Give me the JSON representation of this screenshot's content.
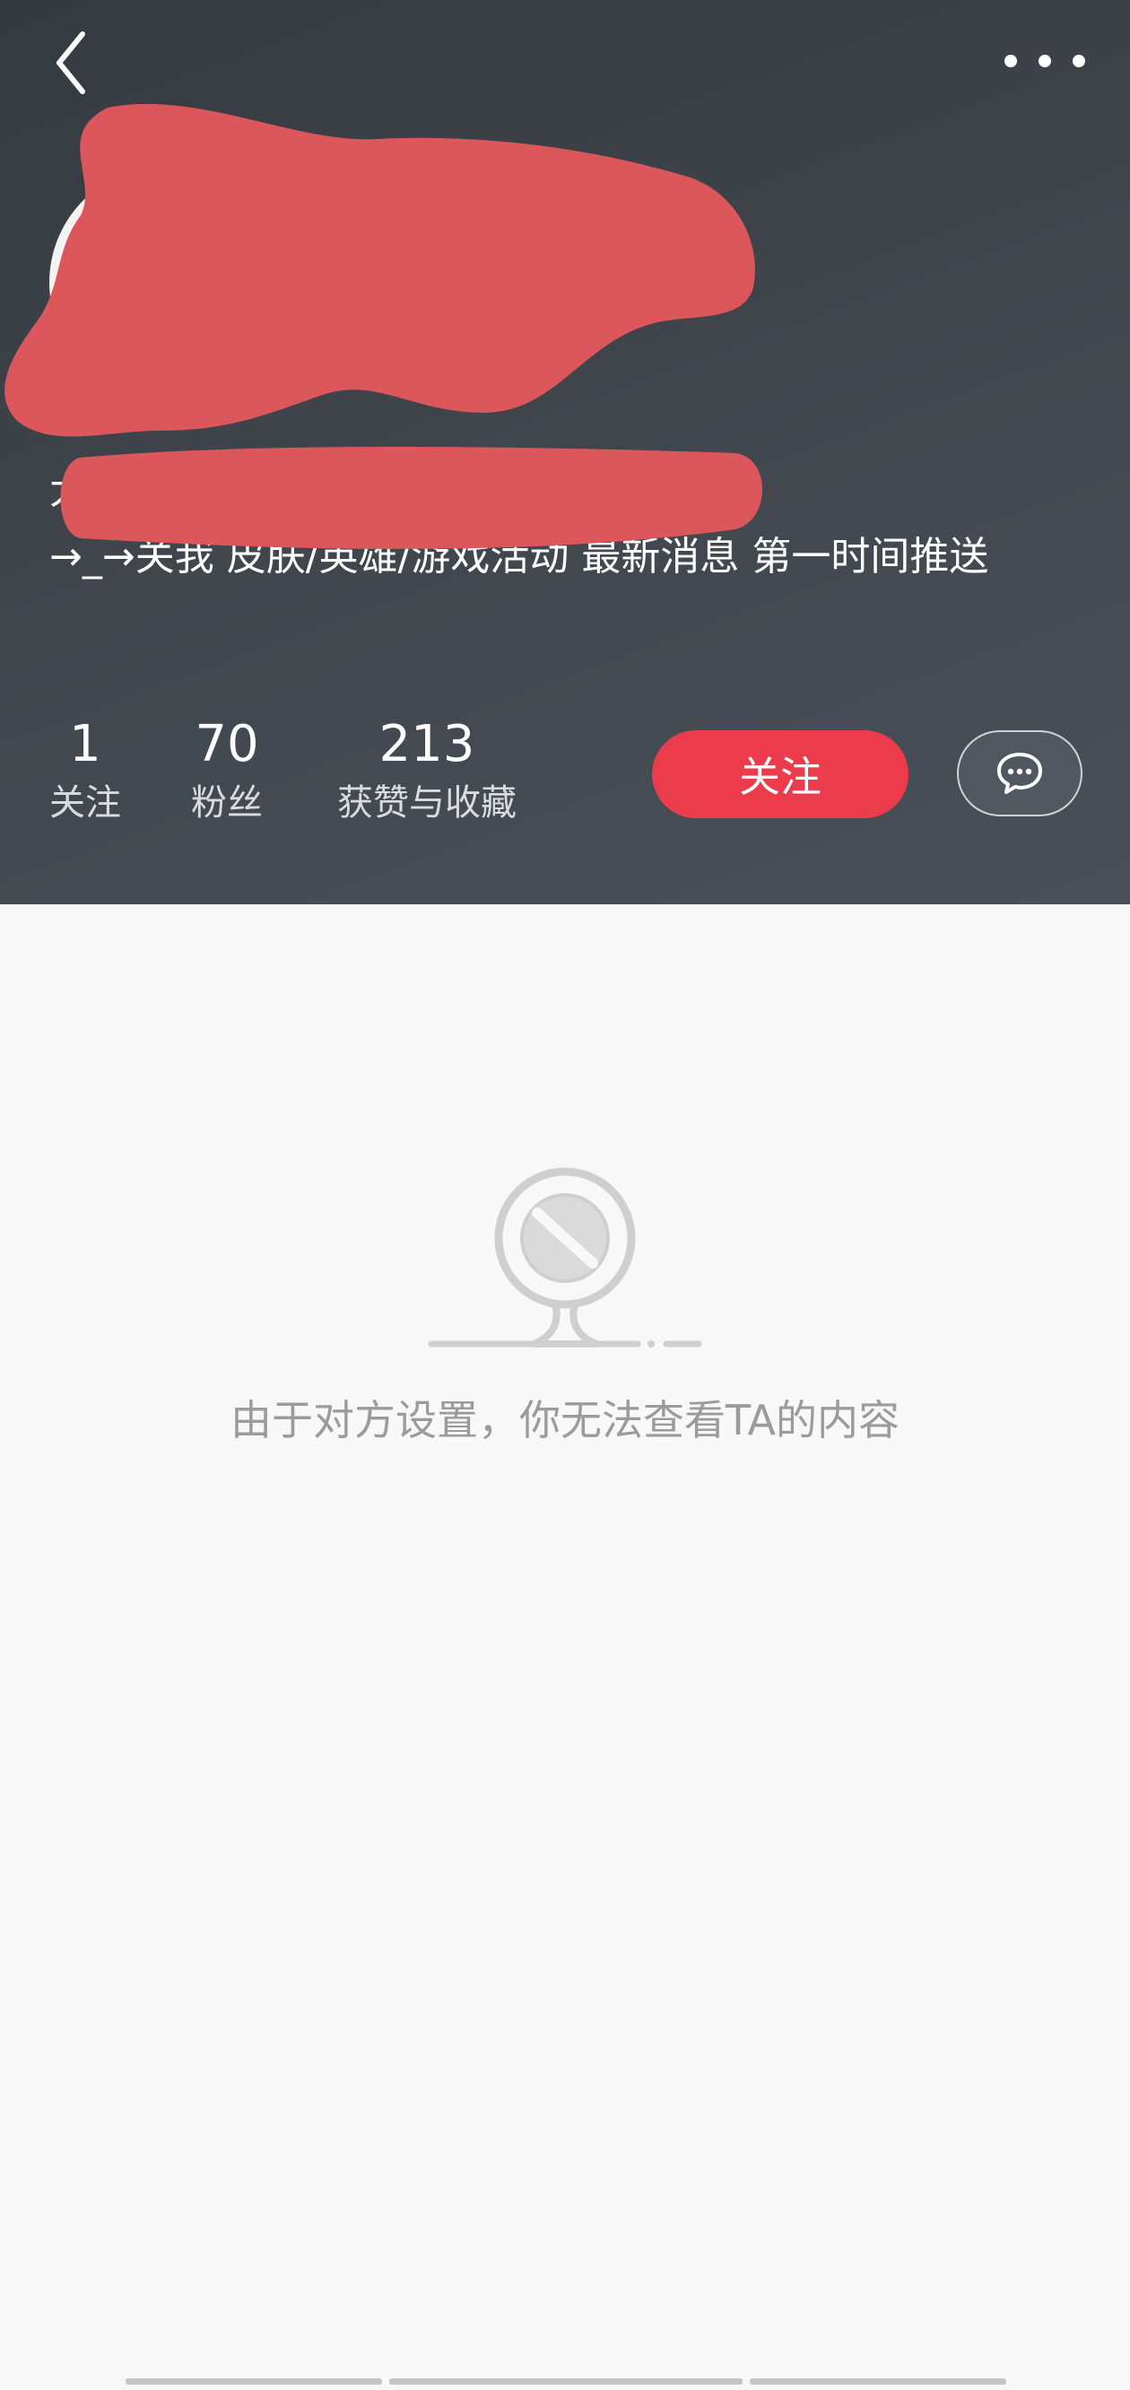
{
  "nav": {
    "back_icon": "chevron-left-icon",
    "more_icon": "more-dots-icon"
  },
  "profile": {
    "bio_line1_visible": "大",
    "bio_line2": "→_→关我 皮肤/英雄/游戏活动 最新消息 第一时间推送"
  },
  "stats": [
    {
      "value": "1",
      "label": "关注"
    },
    {
      "value": "70",
      "label": "粉丝"
    },
    {
      "value": "213",
      "label": "获赞与收藏"
    }
  ],
  "actions": {
    "follow_label": "关注",
    "message_icon": "chat-bubble-icon"
  },
  "empty_state": {
    "icon": "blocked-sign-icon",
    "message": "由于对方设置，你无法查看TA的内容"
  },
  "colors": {
    "header_bg": "#3f454b",
    "accent": "#ec3b4b",
    "redaction": "#dc575c",
    "page_bg": "#f8f8f8"
  }
}
